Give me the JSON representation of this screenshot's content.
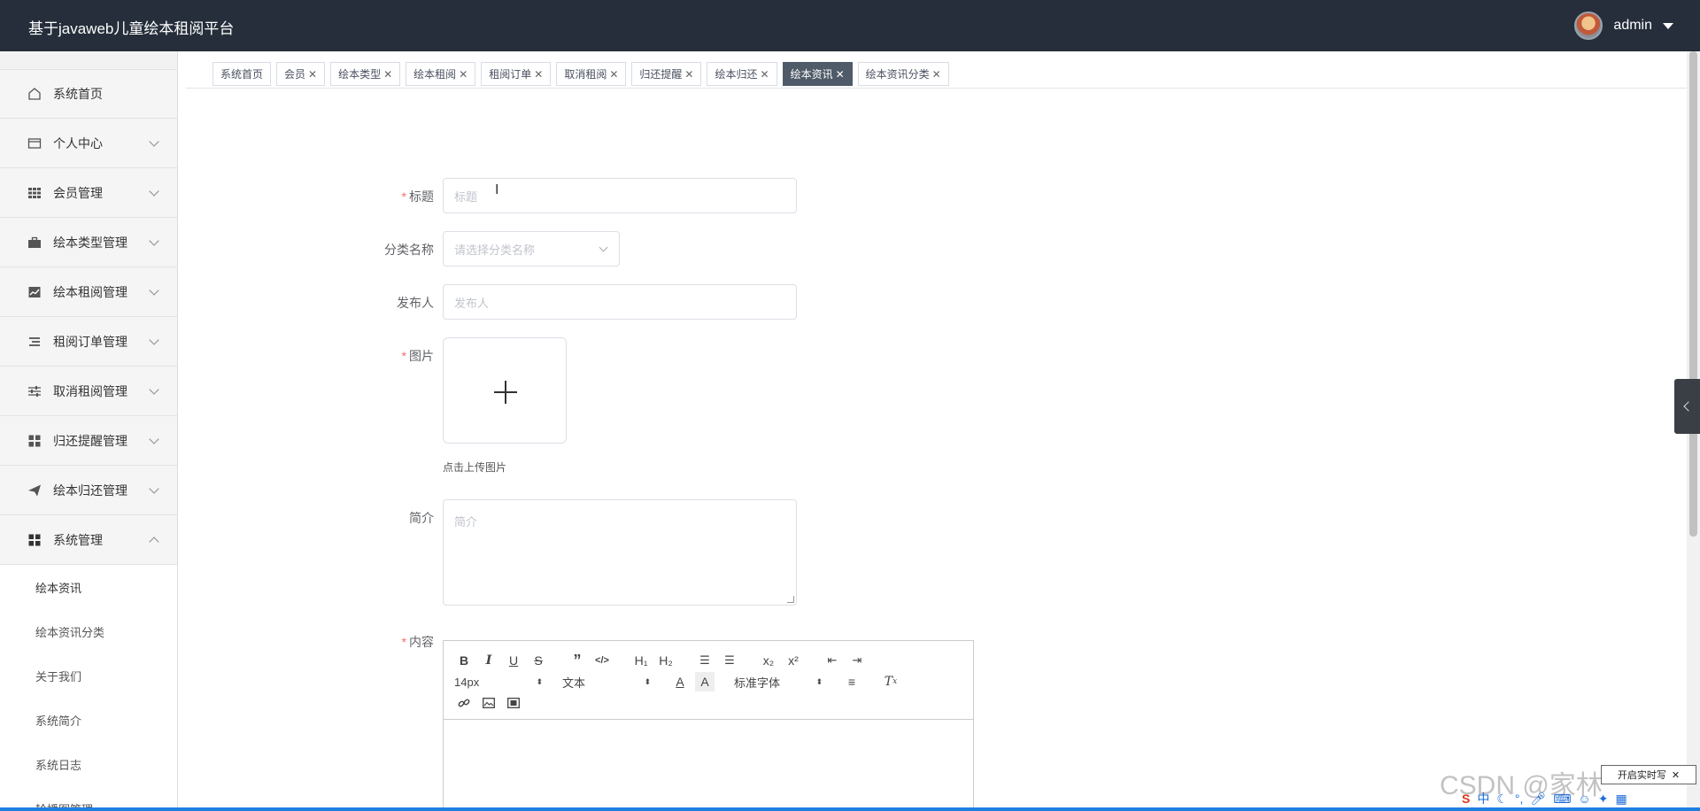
{
  "header": {
    "title": "基于javaweb儿童绘本租阅平台",
    "user_name": "admin"
  },
  "sidebar": {
    "items": [
      {
        "label": "系统首页",
        "icon": "home-icon"
      },
      {
        "label": "个人中心",
        "icon": "card-icon"
      },
      {
        "label": "会员管理",
        "icon": "grid-icon"
      },
      {
        "label": "绘本类型管理",
        "icon": "briefcase-icon"
      },
      {
        "label": "绘本租阅管理",
        "icon": "chart-icon"
      },
      {
        "label": "租阅订单管理",
        "icon": "list-icon"
      },
      {
        "label": "取消租阅管理",
        "icon": "sliders-icon"
      },
      {
        "label": "归还提醒管理",
        "icon": "apps-icon"
      },
      {
        "label": "绘本归还管理",
        "icon": "send-icon"
      },
      {
        "label": "系统管理",
        "icon": "dashboard-icon"
      }
    ],
    "submenu": [
      "绘本资讯",
      "绘本资讯分类",
      "关于我们",
      "系统简介",
      "系统日志",
      "轮播图管理"
    ]
  },
  "tabs": [
    {
      "label": "系统首页",
      "closable": false
    },
    {
      "label": "会员",
      "closable": true
    },
    {
      "label": "绘本类型",
      "closable": true
    },
    {
      "label": "绘本租阅",
      "closable": true
    },
    {
      "label": "租阅订单",
      "closable": true
    },
    {
      "label": "取消租阅",
      "closable": true
    },
    {
      "label": "归还提醒",
      "closable": true
    },
    {
      "label": "绘本归还",
      "closable": true
    },
    {
      "label": "绘本资讯",
      "closable": true,
      "active": true
    },
    {
      "label": "绘本资讯分类",
      "closable": true
    }
  ],
  "form": {
    "title_label": "标题",
    "title_placeholder": "标题",
    "category_label": "分类名称",
    "category_placeholder": "请选择分类名称",
    "publisher_label": "发布人",
    "publisher_placeholder": "发布人",
    "image_label": "图片",
    "upload_tip": "点击上传图片",
    "intro_label": "简介",
    "intro_placeholder": "简介",
    "content_label": "内容"
  },
  "editor": {
    "font_size": "14px",
    "header_select": "文本",
    "font_family": "标准字体"
  },
  "watermark": "CSDN @家林",
  "ime_text": "开启实时写"
}
